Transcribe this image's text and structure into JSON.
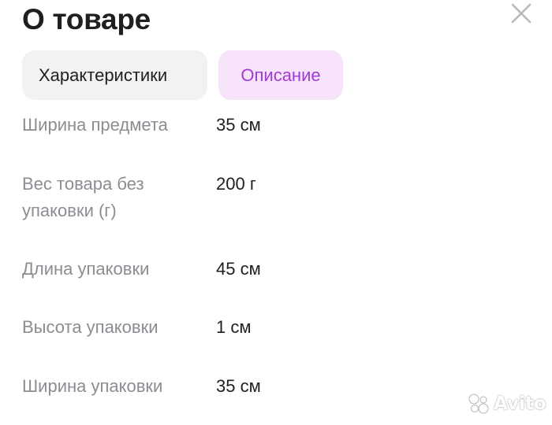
{
  "header": {
    "title": "О товаре",
    "close_icon": "close-icon"
  },
  "tabs": [
    {
      "label": "Характеристики",
      "active": false
    },
    {
      "label": "Описание",
      "active": true
    }
  ],
  "specs": [
    {
      "label": "Ширина предмета",
      "value": "35 см"
    },
    {
      "label": "Вес товара без упаковки (г)",
      "value": "200 г"
    },
    {
      "label": "Длина упаковки",
      "value": "45 см"
    },
    {
      "label": "Высота упаковки",
      "value": "1 см"
    },
    {
      "label": "Ширина упаковки",
      "value": "35 см"
    }
  ],
  "watermark": {
    "text": "Avito",
    "icon": "avito-logo-icon"
  },
  "colors": {
    "accent": "#a23ad6",
    "accent_bg": "#f7e4fb",
    "tab_bg": "#f2f2f5",
    "label_gray": "#8c8c93"
  }
}
